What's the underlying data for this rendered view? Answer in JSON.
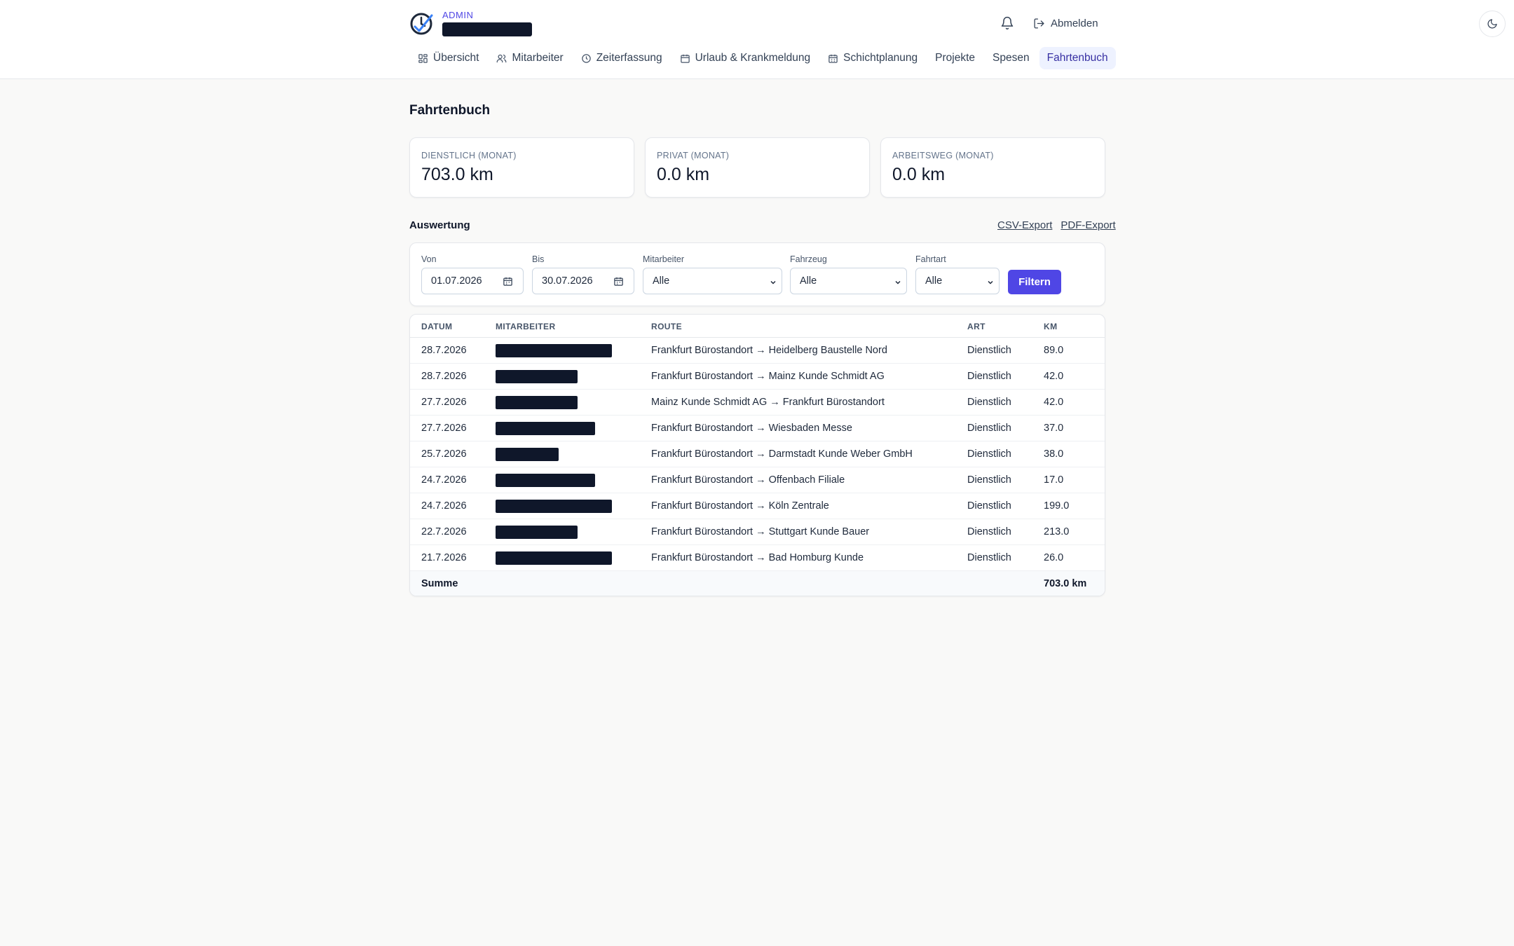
{
  "header": {
    "role_label": "ADMIN",
    "logout_label": "Abmelden",
    "icons": {
      "logo": "clock-check-logo",
      "bell": "bell-icon",
      "logout": "logout-icon",
      "theme": "moon-icon"
    }
  },
  "nav": {
    "items": [
      {
        "label": "Übersicht",
        "icon": "grid-icon"
      },
      {
        "label": "Mitarbeiter",
        "icon": "users-icon"
      },
      {
        "label": "Zeiterfassung",
        "icon": "clock-icon"
      },
      {
        "label": "Urlaub & Krankmeldung",
        "icon": "calendar-icon"
      },
      {
        "label": "Schichtplanung",
        "icon": "calendar-grid-icon"
      },
      {
        "label": "Projekte"
      },
      {
        "label": "Spesen"
      },
      {
        "label": "Fahrtenbuch",
        "active": true
      }
    ]
  },
  "page": {
    "title": "Fahrtenbuch"
  },
  "stats": [
    {
      "label": "DIENSTLICH (MONAT)",
      "value": "703.0 km"
    },
    {
      "label": "PRIVAT (MONAT)",
      "value": "0.0 km"
    },
    {
      "label": "ARBEITSWEG (MONAT)",
      "value": "0.0 km"
    }
  ],
  "report": {
    "title": "Auswertung",
    "csv_export": "CSV-Export",
    "pdf_export": "PDF-Export"
  },
  "filters": {
    "from_label": "Von",
    "from_value": "01.07.2026",
    "to_label": "Bis",
    "to_value": "30.07.2026",
    "employee_label": "Mitarbeiter",
    "employee_value": "Alle",
    "vehicle_label": "Fahrzeug",
    "vehicle_value": "Alle",
    "triptype_label": "Fahrtart",
    "triptype_value": "Alle",
    "button_label": "Filtern"
  },
  "table": {
    "headers": {
      "date": "DATUM",
      "employee": "MITARBEITER",
      "route": "ROUTE",
      "type": "ART",
      "km": "KM"
    },
    "rows": [
      {
        "date": "28.7.2026",
        "route": "Frankfurt Bürostandort → Heidelberg Baustelle Nord",
        "type": "Dienstlich",
        "km": "89.0"
      },
      {
        "date": "28.7.2026",
        "route": "Frankfurt Bürostandort → Mainz Kunde Schmidt AG",
        "type": "Dienstlich",
        "km": "42.0"
      },
      {
        "date": "27.7.2026",
        "route": "Mainz Kunde Schmidt AG → Frankfurt Bürostandort",
        "type": "Dienstlich",
        "km": "42.0"
      },
      {
        "date": "27.7.2026",
        "route": "Frankfurt Bürostandort → Wiesbaden Messe",
        "type": "Dienstlich",
        "km": "37.0"
      },
      {
        "date": "25.7.2026",
        "route": "Frankfurt Bürostandort → Darmstadt Kunde Weber GmbH",
        "type": "Dienstlich",
        "km": "38.0"
      },
      {
        "date": "24.7.2026",
        "route": "Frankfurt Bürostandort → Offenbach Filiale",
        "type": "Dienstlich",
        "km": "17.0"
      },
      {
        "date": "24.7.2026",
        "route": "Frankfurt Bürostandort → Köln Zentrale",
        "type": "Dienstlich",
        "km": "199.0"
      },
      {
        "date": "22.7.2026",
        "route": "Frankfurt Bürostandort → Stuttgart Kunde Bauer",
        "type": "Dienstlich",
        "km": "213.0"
      },
      {
        "date": "21.7.2026",
        "route": "Frankfurt Bürostandort → Bad Homburg Kunde",
        "type": "Dienstlich",
        "km": "26.0"
      }
    ],
    "sum_label": "Summe",
    "sum_value": "703.0 km"
  },
  "colors": {
    "accent": "#4f46e5",
    "nav_active_bg": "#eef2ff",
    "redaction": "#0f172a"
  }
}
